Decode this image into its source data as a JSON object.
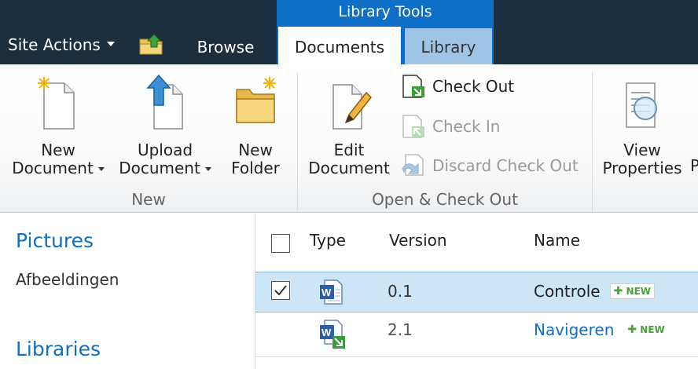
{
  "topbar": {
    "site_actions_label": "Site Actions",
    "context_group_label": "Library Tools",
    "tabs": [
      {
        "label": "Browse"
      },
      {
        "label": "Documents"
      },
      {
        "label": "Library"
      }
    ]
  },
  "ribbon": {
    "groups": [
      {
        "label": "New"
      },
      {
        "label": "Open & Check Out"
      }
    ],
    "new_document": {
      "line1": "New",
      "line2": "Document"
    },
    "upload_document": {
      "line1": "Upload",
      "line2": "Document"
    },
    "new_folder": {
      "line1": "New",
      "line2": "Folder"
    },
    "edit_document": {
      "line1": "Edit",
      "line2": "Document"
    },
    "check_out": "Check Out",
    "check_in": "Check In",
    "discard_check_out": "Discard Check Out",
    "view_properties": {
      "line1": "View",
      "line2": "Properties"
    },
    "cutoff_letter": "P"
  },
  "quicklaunch": {
    "heading1": "Pictures",
    "item1": "Afbeeldingen",
    "heading2": "Libraries"
  },
  "list": {
    "columns": {
      "type": "Type",
      "version": "Version",
      "name": "Name"
    },
    "rows": [
      {
        "version": "0.1",
        "name": "Controle",
        "badge": "NEW",
        "selected": true
      },
      {
        "version": "2.1",
        "name": "Navigeren",
        "badge": "NEW",
        "selected": false
      }
    ]
  },
  "colors": {
    "topbar": "#1c2f3e",
    "context_group": "#0f6fc6",
    "library_tab": "#9fc4e6",
    "link": "#0f6fc6",
    "selected_row": "#cde6f7"
  }
}
